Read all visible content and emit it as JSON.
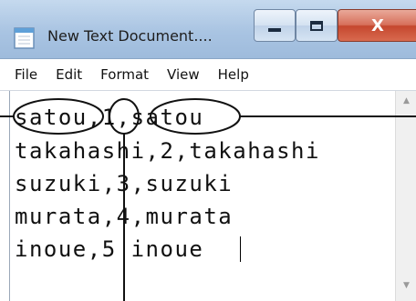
{
  "window": {
    "title": "New Text Document....",
    "close_label": "X"
  },
  "menu": {
    "items": [
      "File",
      "Edit",
      "Format",
      "View",
      "Help"
    ]
  },
  "editor": {
    "lines": [
      "satou,1,satou",
      "takahashi,2,takahashi",
      "suzuki,3,suzuki",
      "murata,4,murata",
      "inoue,5 inoue"
    ]
  },
  "colors": {
    "titlebar": "#a9c4e2",
    "close_button": "#c5472e"
  }
}
